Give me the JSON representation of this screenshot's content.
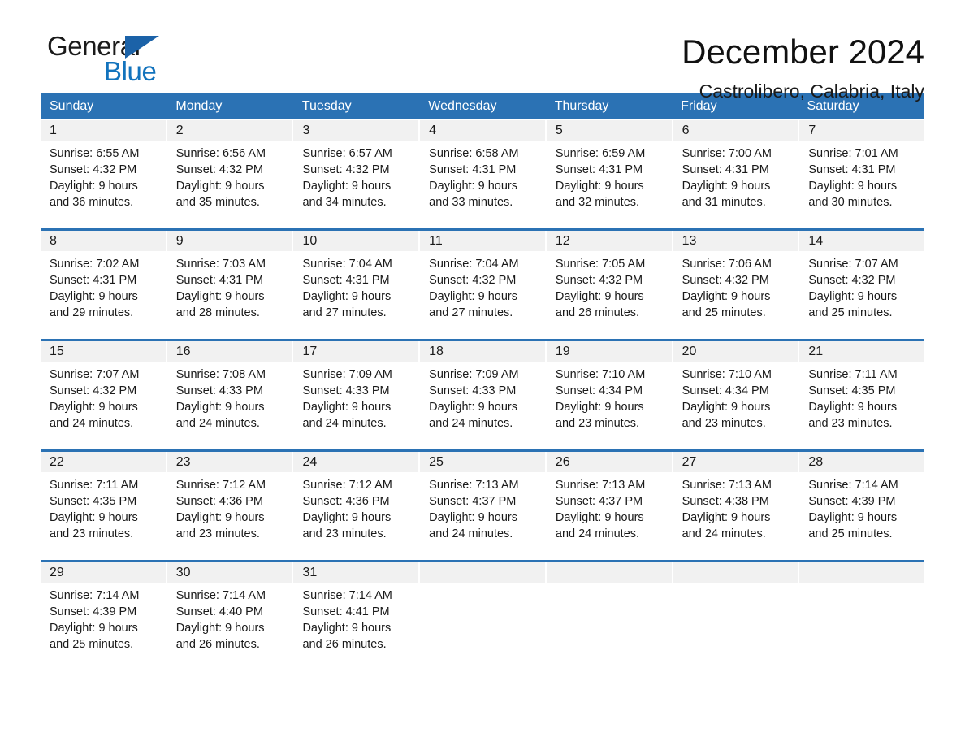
{
  "brand": {
    "name_part1": "General",
    "name_part2": "Blue",
    "flag_icon": "triangle-flag-icon",
    "accent_color": "#1273bd"
  },
  "header": {
    "title": "December 2024",
    "location": "Castrolibero, Calabria, Italy",
    "header_bg_color": "#2b72b4",
    "row_divider_color": "#2b72b4",
    "daynum_band_color": "#f1f1f1"
  },
  "weekdays": [
    "Sunday",
    "Monday",
    "Tuesday",
    "Wednesday",
    "Thursday",
    "Friday",
    "Saturday"
  ],
  "weeks": [
    {
      "days": [
        {
          "day": "1",
          "sunrise": "Sunrise: 6:55 AM",
          "sunset": "Sunset: 4:32 PM",
          "daylight_line1": "Daylight: 9 hours",
          "daylight_line2": "and 36 minutes."
        },
        {
          "day": "2",
          "sunrise": "Sunrise: 6:56 AM",
          "sunset": "Sunset: 4:32 PM",
          "daylight_line1": "Daylight: 9 hours",
          "daylight_line2": "and 35 minutes."
        },
        {
          "day": "3",
          "sunrise": "Sunrise: 6:57 AM",
          "sunset": "Sunset: 4:32 PM",
          "daylight_line1": "Daylight: 9 hours",
          "daylight_line2": "and 34 minutes."
        },
        {
          "day": "4",
          "sunrise": "Sunrise: 6:58 AM",
          "sunset": "Sunset: 4:31 PM",
          "daylight_line1": "Daylight: 9 hours",
          "daylight_line2": "and 33 minutes."
        },
        {
          "day": "5",
          "sunrise": "Sunrise: 6:59 AM",
          "sunset": "Sunset: 4:31 PM",
          "daylight_line1": "Daylight: 9 hours",
          "daylight_line2": "and 32 minutes."
        },
        {
          "day": "6",
          "sunrise": "Sunrise: 7:00 AM",
          "sunset": "Sunset: 4:31 PM",
          "daylight_line1": "Daylight: 9 hours",
          "daylight_line2": "and 31 minutes."
        },
        {
          "day": "7",
          "sunrise": "Sunrise: 7:01 AM",
          "sunset": "Sunset: 4:31 PM",
          "daylight_line1": "Daylight: 9 hours",
          "daylight_line2": "and 30 minutes."
        }
      ]
    },
    {
      "days": [
        {
          "day": "8",
          "sunrise": "Sunrise: 7:02 AM",
          "sunset": "Sunset: 4:31 PM",
          "daylight_line1": "Daylight: 9 hours",
          "daylight_line2": "and 29 minutes."
        },
        {
          "day": "9",
          "sunrise": "Sunrise: 7:03 AM",
          "sunset": "Sunset: 4:31 PM",
          "daylight_line1": "Daylight: 9 hours",
          "daylight_line2": "and 28 minutes."
        },
        {
          "day": "10",
          "sunrise": "Sunrise: 7:04 AM",
          "sunset": "Sunset: 4:31 PM",
          "daylight_line1": "Daylight: 9 hours",
          "daylight_line2": "and 27 minutes."
        },
        {
          "day": "11",
          "sunrise": "Sunrise: 7:04 AM",
          "sunset": "Sunset: 4:32 PM",
          "daylight_line1": "Daylight: 9 hours",
          "daylight_line2": "and 27 minutes."
        },
        {
          "day": "12",
          "sunrise": "Sunrise: 7:05 AM",
          "sunset": "Sunset: 4:32 PM",
          "daylight_line1": "Daylight: 9 hours",
          "daylight_line2": "and 26 minutes."
        },
        {
          "day": "13",
          "sunrise": "Sunrise: 7:06 AM",
          "sunset": "Sunset: 4:32 PM",
          "daylight_line1": "Daylight: 9 hours",
          "daylight_line2": "and 25 minutes."
        },
        {
          "day": "14",
          "sunrise": "Sunrise: 7:07 AM",
          "sunset": "Sunset: 4:32 PM",
          "daylight_line1": "Daylight: 9 hours",
          "daylight_line2": "and 25 minutes."
        }
      ]
    },
    {
      "days": [
        {
          "day": "15",
          "sunrise": "Sunrise: 7:07 AM",
          "sunset": "Sunset: 4:32 PM",
          "daylight_line1": "Daylight: 9 hours",
          "daylight_line2": "and 24 minutes."
        },
        {
          "day": "16",
          "sunrise": "Sunrise: 7:08 AM",
          "sunset": "Sunset: 4:33 PM",
          "daylight_line1": "Daylight: 9 hours",
          "daylight_line2": "and 24 minutes."
        },
        {
          "day": "17",
          "sunrise": "Sunrise: 7:09 AM",
          "sunset": "Sunset: 4:33 PM",
          "daylight_line1": "Daylight: 9 hours",
          "daylight_line2": "and 24 minutes."
        },
        {
          "day": "18",
          "sunrise": "Sunrise: 7:09 AM",
          "sunset": "Sunset: 4:33 PM",
          "daylight_line1": "Daylight: 9 hours",
          "daylight_line2": "and 24 minutes."
        },
        {
          "day": "19",
          "sunrise": "Sunrise: 7:10 AM",
          "sunset": "Sunset: 4:34 PM",
          "daylight_line1": "Daylight: 9 hours",
          "daylight_line2": "and 23 minutes."
        },
        {
          "day": "20",
          "sunrise": "Sunrise: 7:10 AM",
          "sunset": "Sunset: 4:34 PM",
          "daylight_line1": "Daylight: 9 hours",
          "daylight_line2": "and 23 minutes."
        },
        {
          "day": "21",
          "sunrise": "Sunrise: 7:11 AM",
          "sunset": "Sunset: 4:35 PM",
          "daylight_line1": "Daylight: 9 hours",
          "daylight_line2": "and 23 minutes."
        }
      ]
    },
    {
      "days": [
        {
          "day": "22",
          "sunrise": "Sunrise: 7:11 AM",
          "sunset": "Sunset: 4:35 PM",
          "daylight_line1": "Daylight: 9 hours",
          "daylight_line2": "and 23 minutes."
        },
        {
          "day": "23",
          "sunrise": "Sunrise: 7:12 AM",
          "sunset": "Sunset: 4:36 PM",
          "daylight_line1": "Daylight: 9 hours",
          "daylight_line2": "and 23 minutes."
        },
        {
          "day": "24",
          "sunrise": "Sunrise: 7:12 AM",
          "sunset": "Sunset: 4:36 PM",
          "daylight_line1": "Daylight: 9 hours",
          "daylight_line2": "and 23 minutes."
        },
        {
          "day": "25",
          "sunrise": "Sunrise: 7:13 AM",
          "sunset": "Sunset: 4:37 PM",
          "daylight_line1": "Daylight: 9 hours",
          "daylight_line2": "and 24 minutes."
        },
        {
          "day": "26",
          "sunrise": "Sunrise: 7:13 AM",
          "sunset": "Sunset: 4:37 PM",
          "daylight_line1": "Daylight: 9 hours",
          "daylight_line2": "and 24 minutes."
        },
        {
          "day": "27",
          "sunrise": "Sunrise: 7:13 AM",
          "sunset": "Sunset: 4:38 PM",
          "daylight_line1": "Daylight: 9 hours",
          "daylight_line2": "and 24 minutes."
        },
        {
          "day": "28",
          "sunrise": "Sunrise: 7:14 AM",
          "sunset": "Sunset: 4:39 PM",
          "daylight_line1": "Daylight: 9 hours",
          "daylight_line2": "and 25 minutes."
        }
      ]
    },
    {
      "days": [
        {
          "day": "29",
          "sunrise": "Sunrise: 7:14 AM",
          "sunset": "Sunset: 4:39 PM",
          "daylight_line1": "Daylight: 9 hours",
          "daylight_line2": "and 25 minutes."
        },
        {
          "day": "30",
          "sunrise": "Sunrise: 7:14 AM",
          "sunset": "Sunset: 4:40 PM",
          "daylight_line1": "Daylight: 9 hours",
          "daylight_line2": "and 26 minutes."
        },
        {
          "day": "31",
          "sunrise": "Sunrise: 7:14 AM",
          "sunset": "Sunset: 4:41 PM",
          "daylight_line1": "Daylight: 9 hours",
          "daylight_line2": "and 26 minutes."
        },
        {
          "day": "",
          "sunrise": "",
          "sunset": "",
          "daylight_line1": "",
          "daylight_line2": ""
        },
        {
          "day": "",
          "sunrise": "",
          "sunset": "",
          "daylight_line1": "",
          "daylight_line2": ""
        },
        {
          "day": "",
          "sunrise": "",
          "sunset": "",
          "daylight_line1": "",
          "daylight_line2": ""
        },
        {
          "day": "",
          "sunrise": "",
          "sunset": "",
          "daylight_line1": "",
          "daylight_line2": ""
        }
      ]
    }
  ]
}
